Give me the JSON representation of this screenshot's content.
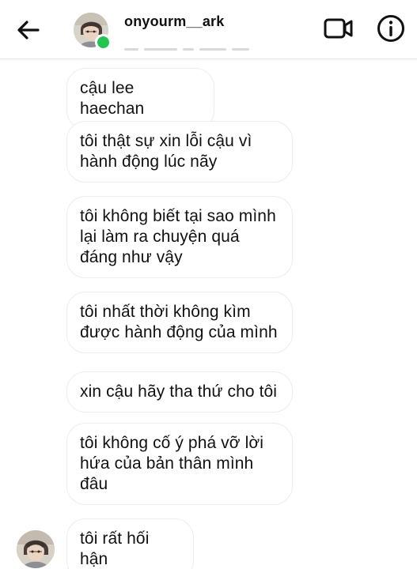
{
  "header": {
    "username": "onyourm__ark"
  },
  "messages": [
    {
      "text": "cậu lee haechan"
    },
    {
      "text": "tôi thật sự xin lỗi cậu vì\nhành động lúc nãy"
    },
    {
      "text": "tôi không biết tại sao mình\nlại làm ra chuyện quá\nđáng như vậy"
    },
    {
      "text": "tôi nhất thời không kìm\nđược hành động của mình"
    },
    {
      "text": "xin cậu hãy tha thứ cho tôi"
    },
    {
      "text": "tôi không cố ý phá vỡ lời\nhứa của bản thân mình\nđâu"
    },
    {
      "text": "tôi rất hối hận"
    }
  ],
  "colors": {
    "online": "#23c552",
    "bubble_border": "#ececec",
    "text": "#111111"
  },
  "icons": {
    "back": "arrow-left",
    "video": "video-camera",
    "info": "info-circle",
    "status": "online-dot"
  }
}
